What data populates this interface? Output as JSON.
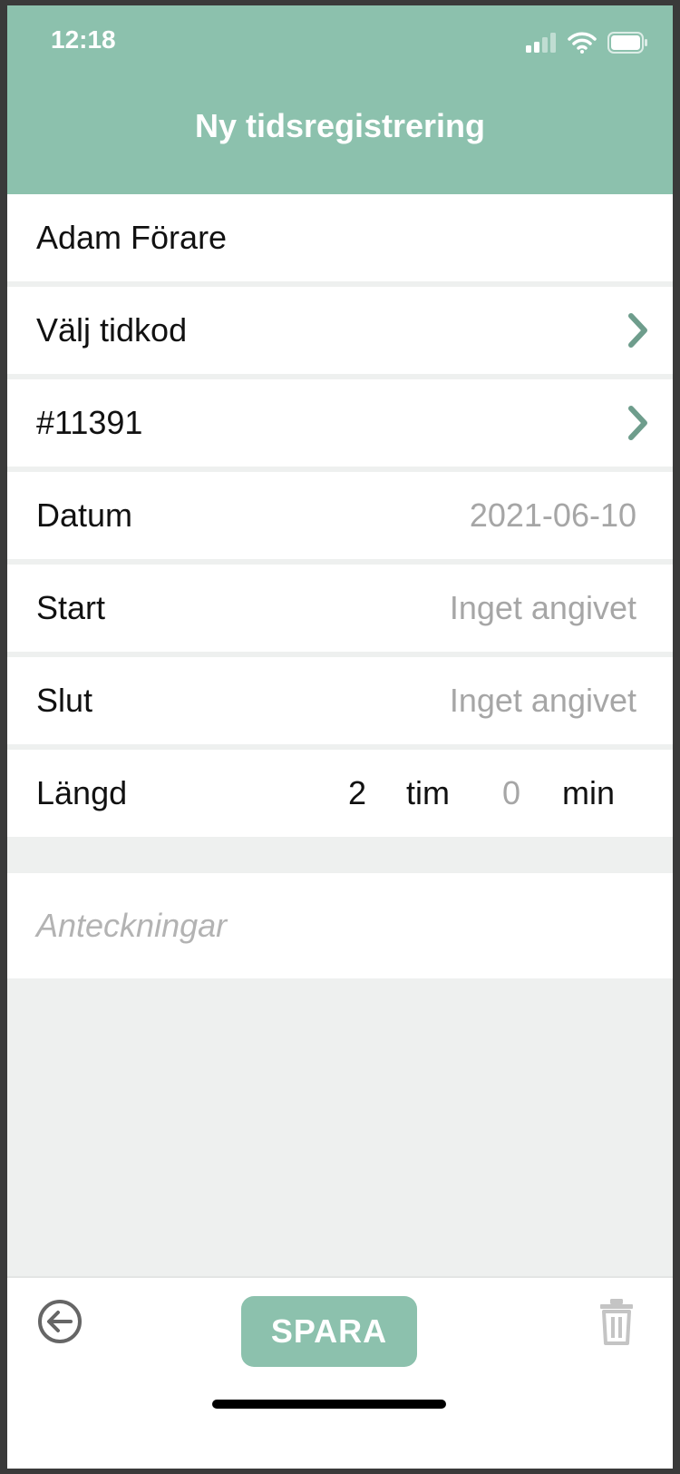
{
  "status_bar": {
    "time": "12:18",
    "icons": [
      "signal-icon",
      "wifi-icon",
      "battery-icon"
    ]
  },
  "header": {
    "title": "Ny tidsregistrering"
  },
  "form": {
    "driver": "Adam Förare",
    "time_code": "Välj tidkod",
    "order": "#11391",
    "date_label": "Datum",
    "date_value": "2021-06-10",
    "start_label": "Start",
    "start_value": "Inget angivet",
    "end_label": "Slut",
    "end_value": "Inget angivet",
    "length_label": "Längd",
    "hours_value": "2",
    "hours_unit": "tim",
    "minutes_value": "0",
    "minutes_unit": "min",
    "notes_placeholder": "Anteckningar"
  },
  "footer": {
    "save_label": "SPARA",
    "back_icon": "back-arrow-icon",
    "delete_icon": "trash-icon"
  },
  "colors": {
    "accent": "#8cc1ad",
    "chevron": "#6e9d8c",
    "placeholder": "#a6a6a6",
    "background": "#eef0ef"
  }
}
